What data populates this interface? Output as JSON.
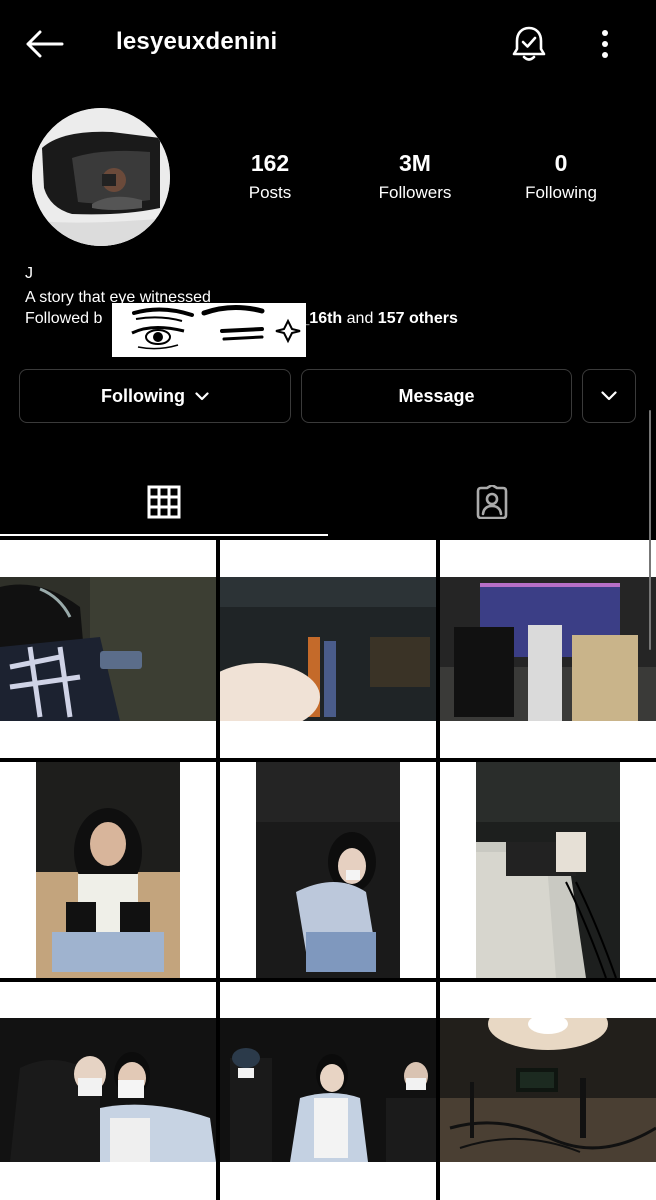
{
  "header": {
    "username": "lesyeuxdenini",
    "back_icon": "arrow-left-icon",
    "bell_icon": "bell-check-icon",
    "more_icon": "more-vertical-icon"
  },
  "stats": {
    "posts_value": "162",
    "posts_label": "Posts",
    "followers_value": "3M",
    "followers_label": "Followers",
    "following_value": "0",
    "following_label": "Following"
  },
  "bio": {
    "name": "J",
    "text": "A story that eye witnessed",
    "followed_prefix": "Followed b",
    "followed_user_suffix": "ary_16th",
    "followed_and": " and ",
    "followed_others": "157 others"
  },
  "actions": {
    "following_label": "Following",
    "message_label": "Message"
  },
  "tabs": {
    "grid_icon": "grid-icon",
    "tagged_icon": "tagged-user-icon",
    "active": "grid"
  },
  "colors": {
    "background": "#000000",
    "text": "#ffffff",
    "button_border": "#3a3a3a"
  }
}
